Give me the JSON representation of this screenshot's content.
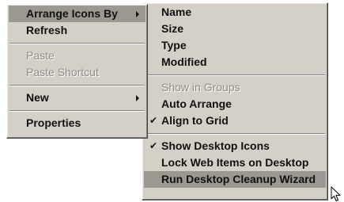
{
  "context_menu": {
    "items": [
      {
        "label": "Arrange Icons By",
        "submenu": true,
        "state": "open"
      },
      {
        "label": "Refresh"
      },
      {
        "label": "Paste",
        "disabled": true
      },
      {
        "label": "Paste Shortcut",
        "disabled": true
      },
      {
        "label": "New",
        "submenu": true
      },
      {
        "label": "Properties"
      }
    ]
  },
  "submenu": {
    "items": [
      {
        "label": "Name"
      },
      {
        "label": "Size"
      },
      {
        "label": "Type"
      },
      {
        "label": "Modified"
      },
      {
        "label": "Show in Groups",
        "disabled": true
      },
      {
        "label": "Auto Arrange"
      },
      {
        "label": "Align to Grid",
        "checked": true
      },
      {
        "label": "Show Desktop Icons",
        "checked": true
      },
      {
        "label": "Lock Web Items on Desktop"
      },
      {
        "label": "Run Desktop Cleanup Wizard",
        "highlighted": true
      }
    ],
    "check_glyph": "✔"
  },
  "icons": {
    "submenu_arrow": "submenu-arrow-icon",
    "check": "checkmark-icon",
    "cursor": "mouse-pointer-icon"
  },
  "colors": {
    "menu_background": "#d4d0c8",
    "highlight": "#9a9890",
    "disabled_text": "#8f8c86"
  }
}
